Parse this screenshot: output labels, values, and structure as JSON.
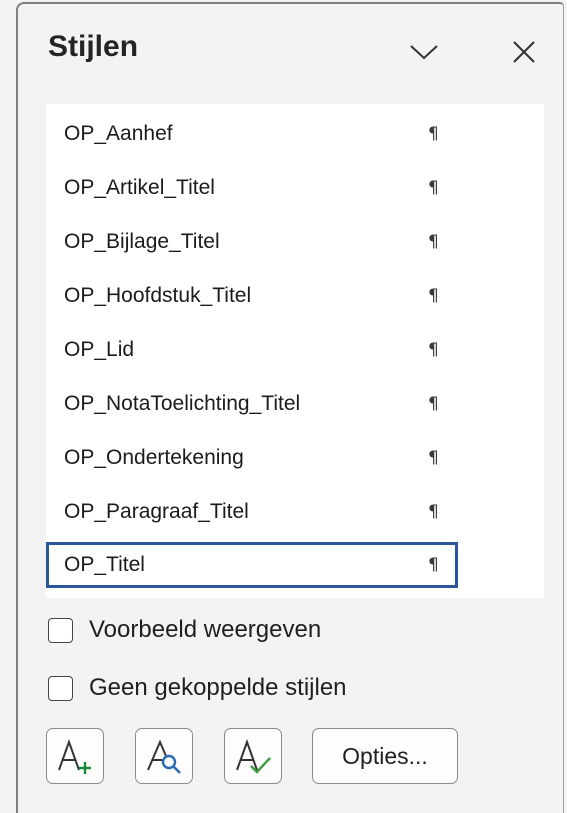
{
  "panel": {
    "title": "Stijlen",
    "header_icons": [
      "chevron-down-icon",
      "close-icon"
    ]
  },
  "styles_list": {
    "pilcrow": "¶",
    "items": [
      {
        "label": "OP_Aanhef"
      },
      {
        "label": "OP_Artikel_Titel"
      },
      {
        "label": "OP_Bijlage_Titel"
      },
      {
        "label": "OP_Hoofdstuk_Titel"
      },
      {
        "label": "OP_Lid"
      },
      {
        "label": "OP_NotaToelichting_Titel"
      },
      {
        "label": "OP_Ondertekening"
      },
      {
        "label": "OP_Paragraaf_Titel"
      },
      {
        "label": "OP_Titel",
        "selected": true
      }
    ]
  },
  "options": {
    "show_preview": {
      "label": "Voorbeeld weergeven",
      "checked": false
    },
    "disable_linked": {
      "label": "Geen gekoppelde stijlen",
      "checked": false
    }
  },
  "toolbar": {
    "buttons": [
      {
        "icon": "new-style-icon"
      },
      {
        "icon": "style-inspector-icon"
      },
      {
        "icon": "manage-styles-icon"
      }
    ],
    "options_label": "Opties..."
  },
  "colors": {
    "selection_border": "#2b579a",
    "new_style_plus": "#1e8a3c",
    "inspector_lens": "#2b6cb0",
    "manage_check": "#3c9a3c"
  }
}
